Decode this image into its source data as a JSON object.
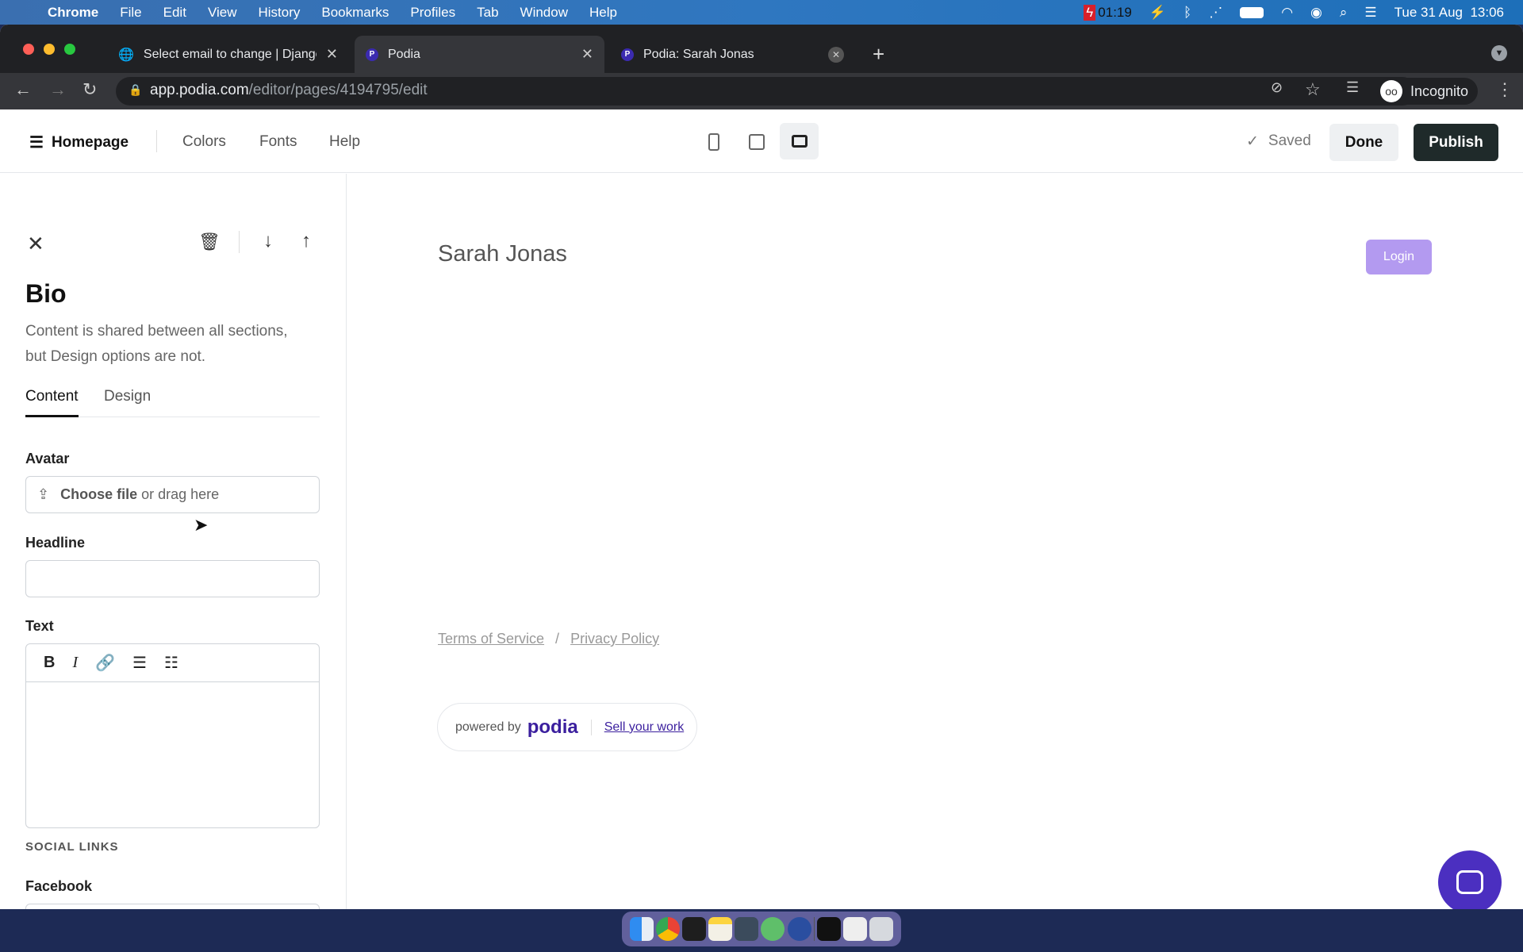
{
  "menubar": {
    "apple": "",
    "items": [
      "Chrome",
      "File",
      "Edit",
      "View",
      "History",
      "Bookmarks",
      "Profiles",
      "Tab",
      "Window",
      "Help"
    ],
    "recording": "01:19",
    "datetime": "Tue 31 Aug  13:06"
  },
  "tabs": [
    {
      "title": "Select email to change | Django",
      "favicon": "globe-icon"
    },
    {
      "title": "Podia",
      "favicon": "P"
    },
    {
      "title": "Podia: Sarah Jonas",
      "favicon": "P"
    }
  ],
  "address": {
    "host": "app.podia.com",
    "path": "/editor/pages/4194795/edit",
    "profile": "Incognito"
  },
  "header": {
    "page": "Homepage",
    "links": [
      "Colors",
      "Fonts",
      "Help"
    ],
    "saved": "Saved",
    "done": "Done",
    "publish": "Publish",
    "active_device": "desktop"
  },
  "panel": {
    "title": "Bio",
    "description_1": "Content is shared between all sections,",
    "description_2": "but Design options are not.",
    "tabs": [
      "Content",
      "Design"
    ],
    "active_tab": "Content",
    "avatar_label": "Avatar",
    "choose_file": "Choose file",
    "drag_here": " or drag here",
    "headline_label": "Headline",
    "headline_value": "",
    "text_label": "Text",
    "social_heading": "SOCIAL LINKS",
    "facebook_label": "Facebook"
  },
  "preview": {
    "site_name": "Sarah Jonas",
    "login": "Login",
    "terms": "Terms of Service",
    "separator": "/",
    "privacy": "Privacy Policy",
    "powered_by": "powered by",
    "brand": "podia",
    "sell": "Sell your work"
  },
  "colors": {
    "accent": "#b39af0",
    "brand": "#3b1f9e",
    "chat": "#4b2fc0",
    "publish": "#1f2a2a"
  }
}
